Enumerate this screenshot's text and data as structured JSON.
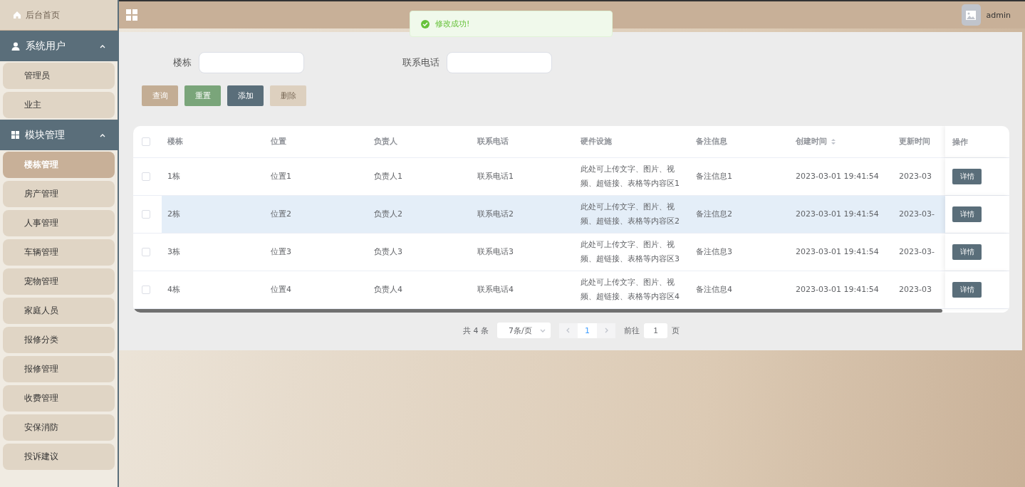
{
  "sidebar": {
    "home": {
      "label": "后台首页"
    },
    "groups": [
      {
        "label": "系统用户",
        "expanded": true,
        "items": [
          {
            "label": "管理员",
            "selected": false
          },
          {
            "label": "业主",
            "selected": false
          }
        ]
      },
      {
        "label": "模块管理",
        "expanded": true,
        "items": [
          {
            "label": "楼栋管理",
            "selected": true
          },
          {
            "label": "房产管理",
            "selected": false
          },
          {
            "label": "人事管理",
            "selected": false
          },
          {
            "label": "车辆管理",
            "selected": false
          },
          {
            "label": "宠物管理",
            "selected": false
          },
          {
            "label": "家庭人员",
            "selected": false
          },
          {
            "label": "报修分类",
            "selected": false
          },
          {
            "label": "报修管理",
            "selected": false
          },
          {
            "label": "收费管理",
            "selected": false
          },
          {
            "label": "安保消防",
            "selected": false
          },
          {
            "label": "投诉建议",
            "selected": false
          }
        ]
      }
    ]
  },
  "header": {
    "user": "admin"
  },
  "toast": {
    "message": "修改成功!"
  },
  "search": {
    "fields": [
      {
        "label": "楼栋"
      },
      {
        "label": "联系电话"
      }
    ],
    "buttons": [
      {
        "label": "查询",
        "kind": "search",
        "disabled": false
      },
      {
        "label": "重置",
        "kind": "reset",
        "disabled": false
      },
      {
        "label": "添加",
        "kind": "add",
        "disabled": false
      },
      {
        "label": "删除",
        "kind": "delete",
        "disabled": true
      }
    ]
  },
  "table": {
    "columns": [
      {
        "label": "楼栋",
        "sortable": false
      },
      {
        "label": "位置",
        "sortable": false
      },
      {
        "label": "负责人",
        "sortable": false
      },
      {
        "label": "联系电话",
        "sortable": false
      },
      {
        "label": "硬件设施",
        "sortable": false
      },
      {
        "label": "备注信息",
        "sortable": false
      },
      {
        "label": "创建时间",
        "sortable": true
      },
      {
        "label": "更新时间",
        "sortable": false
      }
    ],
    "action_column": "操作",
    "all_checked": false,
    "rows": [
      {
        "checked": false,
        "highlighted": false,
        "cells": [
          "1栋",
          "位置1",
          "负责人1",
          "联系电话1",
          "此处可上传文字、图片、视频、超链接、表格等内容区1",
          "备注信息1",
          "2023-03-01 19:41:54",
          "2023-03"
        ],
        "action": "详情"
      },
      {
        "checked": false,
        "highlighted": true,
        "cells": [
          "2栋",
          "位置2",
          "负责人2",
          "联系电话2",
          "此处可上传文字、图片、视频、超链接、表格等内容区2",
          "备注信息2",
          "2023-03-01 19:41:54",
          "2023-03-"
        ],
        "action": "详情"
      },
      {
        "checked": false,
        "highlighted": false,
        "cells": [
          "3栋",
          "位置3",
          "负责人3",
          "联系电话3",
          "此处可上传文字、图片、视频、超链接、表格等内容区3",
          "备注信息3",
          "2023-03-01 19:41:54",
          "2023-03-"
        ],
        "action": "详情"
      },
      {
        "checked": false,
        "highlighted": false,
        "cells": [
          "4栋",
          "位置4",
          "负责人4",
          "联系电话4",
          "此处可上传文字、图片、视频、超链接、表格等内容区4",
          "备注信息4",
          "2023-03-01 19:41:54",
          "2023-03"
        ],
        "action": "详情"
      }
    ]
  },
  "pagination": {
    "total": "共 4 条",
    "page_size": "7条/页",
    "pages": [
      {
        "label": "1",
        "selected": true
      }
    ],
    "goto_label": "前往",
    "goto_value": "1",
    "goto_suffix": "页"
  }
}
